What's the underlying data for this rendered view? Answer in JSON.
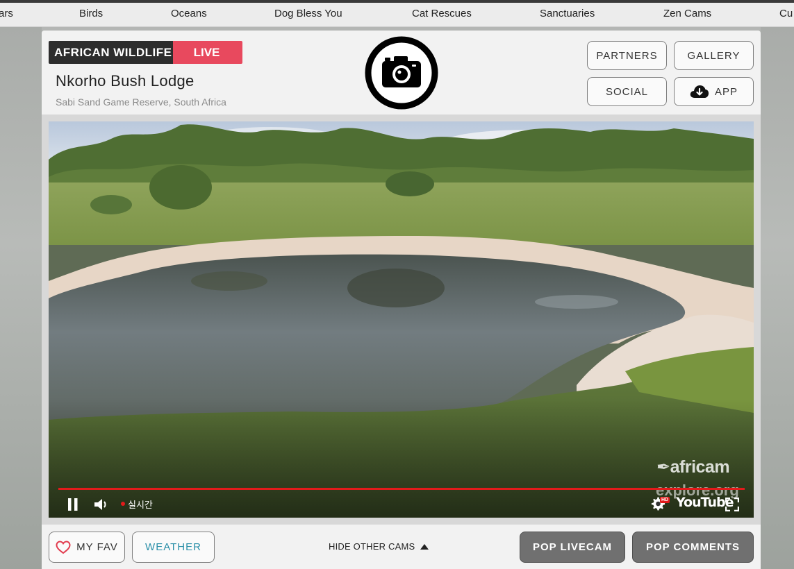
{
  "nav": {
    "items": [
      "ars",
      "Birds",
      "Oceans",
      "Dog Bless You",
      "Cat Rescues",
      "Sanctuaries",
      "Zen Cams",
      "Cu"
    ]
  },
  "header": {
    "category": "AFRICAN WILDLIFE",
    "live_label": "LIVE",
    "title": "Nkorho Bush Lodge",
    "location": "Sabi Sand Game Reserve, South Africa",
    "buttons": {
      "partners": "PARTNERS",
      "gallery": "GALLERY",
      "social": "SOCIAL",
      "app": "APP"
    },
    "icons": {
      "logo": "camera-icon",
      "app": "cloud-download-icon"
    }
  },
  "video": {
    "live_indicator": "실시간",
    "watermark_brand": "africam",
    "watermark_site": "explore.org",
    "player_brand": "YouTube",
    "hd_badge": "HD",
    "progress_percent": 100,
    "controls": [
      "pause-icon",
      "volume-icon",
      "settings-icon",
      "fullscreen-icon"
    ]
  },
  "toolbar": {
    "fav_label": "MY FAV",
    "weather_label": "WEATHER",
    "hide_cams_label": "HIDE OTHER CAMS",
    "pop_livecam_label": "POP LIVECAM",
    "pop_comments_label": "POP COMMENTS"
  },
  "colors": {
    "live_badge": "#e8495e",
    "category_badge": "#2d2d2d",
    "weather_text": "#2a8fa8",
    "progress_bar": "#e21b1b",
    "fav_heart": "#e23b4e"
  }
}
